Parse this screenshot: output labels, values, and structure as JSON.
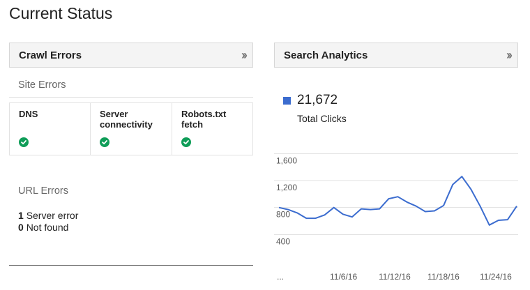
{
  "page": {
    "title": "Current Status"
  },
  "crawl_errors": {
    "title": "Crawl Errors",
    "site_errors_label": "Site Errors",
    "site_errors": [
      {
        "label": "DNS",
        "status": "ok"
      },
      {
        "label": "Server connectivity",
        "status": "ok"
      },
      {
        "label": "Robots.txt fetch",
        "status": "ok"
      }
    ],
    "url_errors_label": "URL Errors",
    "url_errors": [
      {
        "count": "1",
        "label": "Server error"
      },
      {
        "count": "0",
        "label": "Not found"
      }
    ]
  },
  "search_analytics": {
    "title": "Search Analytics",
    "total_value": "21,672",
    "total_label": "Total Clicks",
    "legend_color": "#3b6ccf"
  },
  "chart_data": {
    "type": "line",
    "x_tick_labels": [
      "...",
      "11/6/16",
      "11/12/16",
      "11/18/16",
      "11/24/16"
    ],
    "y_tick_labels": [
      "1,600",
      "1,200",
      "800",
      "400"
    ],
    "ylim": [
      0,
      1800
    ],
    "grid": true,
    "series": [
      {
        "values": [
          800,
          770,
          720,
          640,
          640,
          690,
          800,
          700,
          660,
          780,
          770,
          780,
          930,
          960,
          880,
          820,
          740,
          750,
          830,
          1140,
          1260,
          1070,
          820,
          540,
          610,
          620,
          820
        ]
      }
    ]
  }
}
